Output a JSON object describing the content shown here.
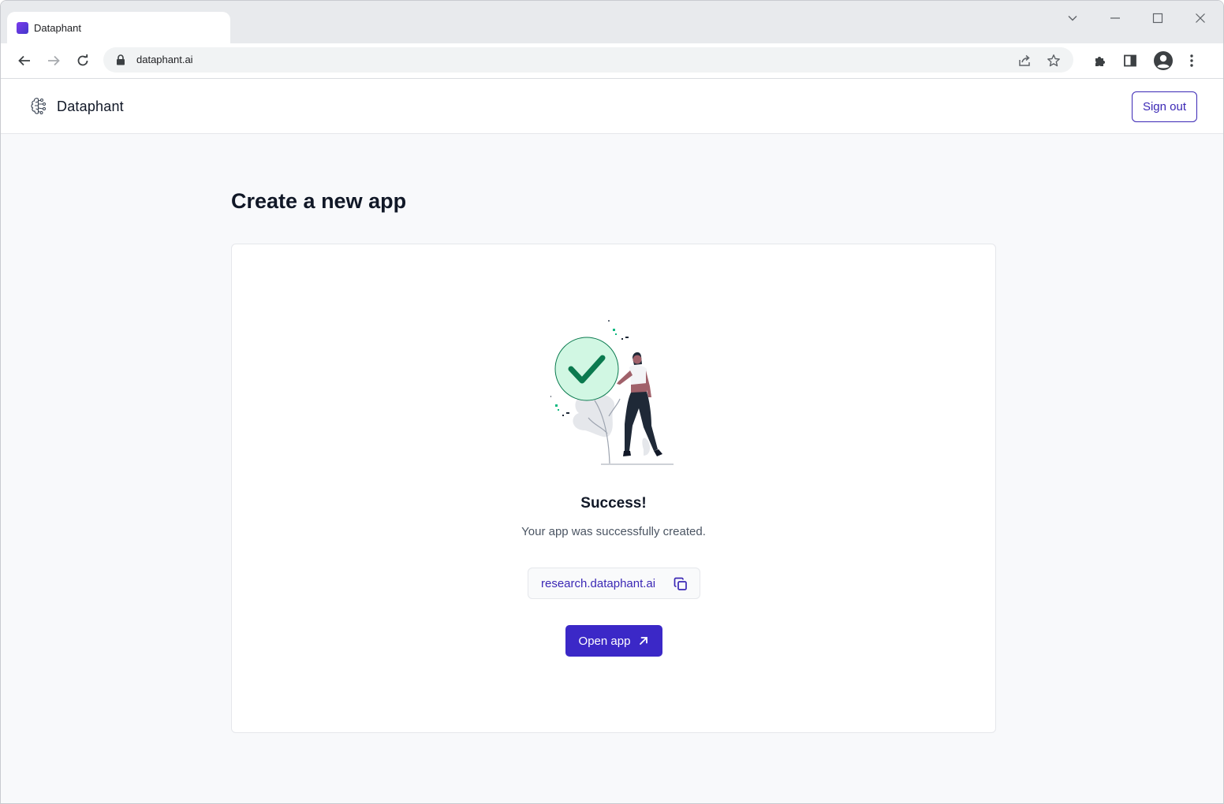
{
  "browser": {
    "tab_title": "Dataphant",
    "url": "dataphant.ai"
  },
  "header": {
    "brand": "Dataphant",
    "sign_out_label": "Sign out"
  },
  "main": {
    "heading": "Create a new app",
    "success_title": "Success!",
    "success_message": "Your app was successfully created.",
    "app_url": "research.dataphant.ai",
    "open_app_label": "Open app"
  },
  "colors": {
    "accent": "#3b28c7",
    "success_green": "#0b7a4f",
    "success_circle": "#d1f7e3"
  }
}
